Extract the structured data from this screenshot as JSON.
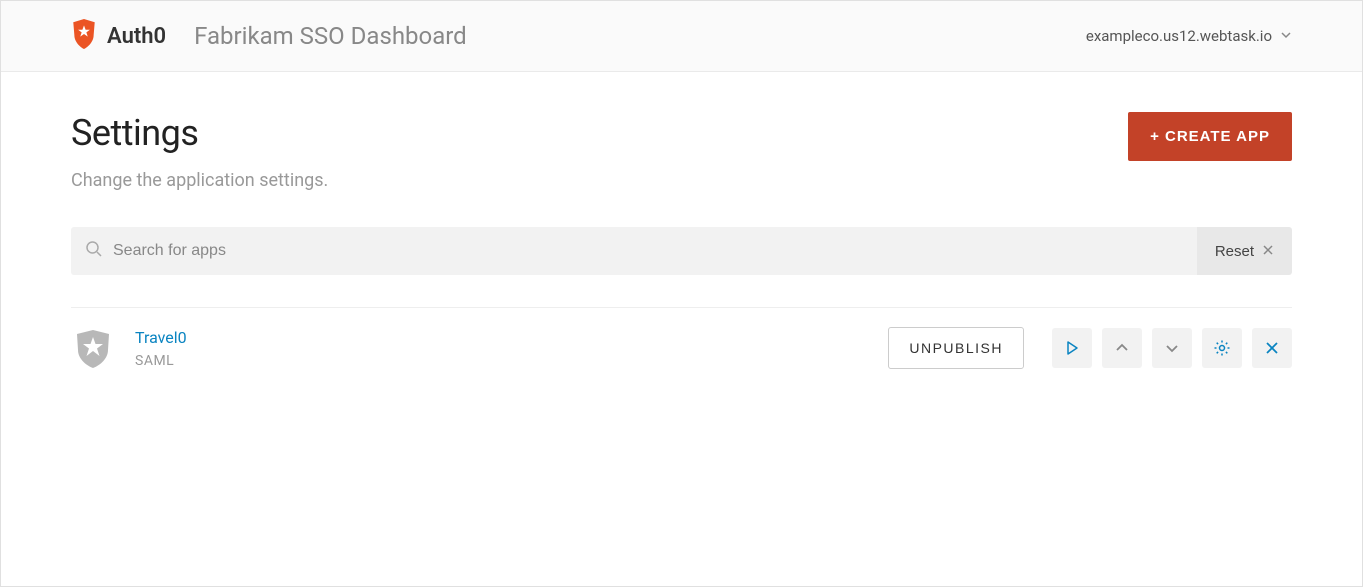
{
  "header": {
    "logo_text": "Auth0",
    "app_title": "Fabrikam SSO Dashboard",
    "domain": "exampleco.us12.webtask.io"
  },
  "page": {
    "title": "Settings",
    "subtitle": "Change the application settings.",
    "create_button": "+ CREATE APP"
  },
  "search": {
    "placeholder": "Search for apps",
    "reset_label": "Reset"
  },
  "apps": [
    {
      "name": "Travel0",
      "type": "SAML",
      "action_label": "UNPUBLISH"
    }
  ]
}
